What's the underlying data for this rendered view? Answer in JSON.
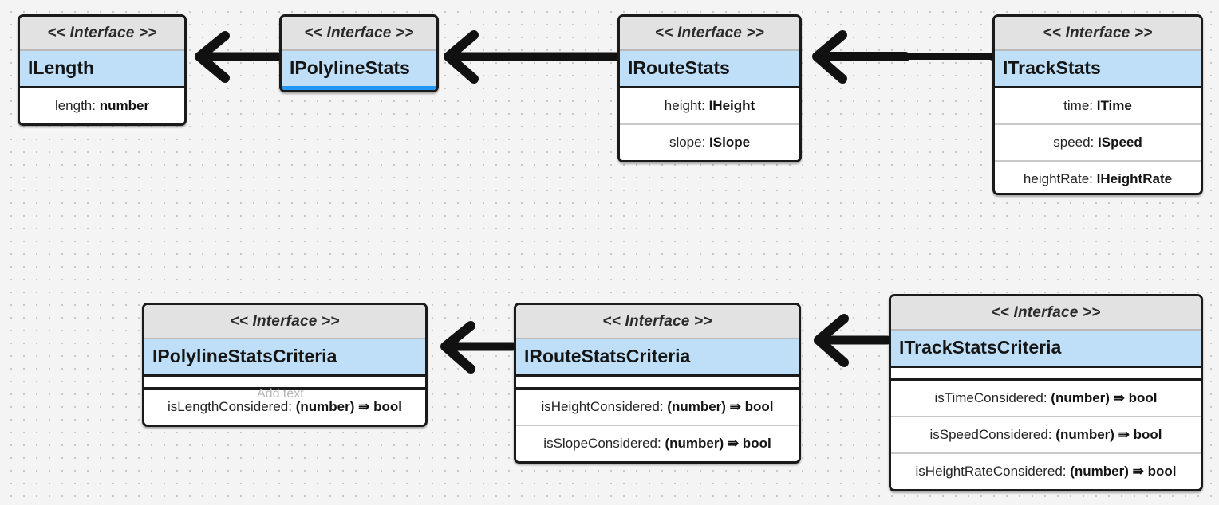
{
  "diagram": {
    "type": "uml-class-diagram",
    "stereotype_label": "<< Interface >>",
    "placeholder_text": "Add text",
    "canvas_background": "#f4f4f4",
    "grid_dot_color": "#c8c8c8",
    "accent_color": "#2196f3",
    "title_band_color": "#bfdef7",
    "stereotype_band_color": "#e2e2e2",
    "border_color": "#1a1a1a",
    "relationship_kind": "generalization-arrow",
    "interfaces": [
      {
        "id": "ilength",
        "name": "ILength",
        "stereotype": "<< Interface >>",
        "selected": false,
        "has_empty_compartment": false,
        "has_tail_compartment": false,
        "members": [
          {
            "label": "length:",
            "type": "number"
          }
        ]
      },
      {
        "id": "ipolylinestats",
        "name": "IPolylineStats",
        "stereotype": "<< Interface >>",
        "selected": true,
        "has_empty_compartment": false,
        "has_tail_compartment": false,
        "members": []
      },
      {
        "id": "iroutestats",
        "name": "IRouteStats",
        "stereotype": "<< Interface >>",
        "selected": false,
        "has_empty_compartment": false,
        "has_tail_compartment": false,
        "members": [
          {
            "label": "height:",
            "type": "IHeight"
          },
          {
            "label": "slope:",
            "type": "ISlope"
          }
        ]
      },
      {
        "id": "itrackstats",
        "name": "ITrackStats",
        "stereotype": "<< Interface >>",
        "selected": false,
        "has_empty_compartment": false,
        "has_tail_compartment": true,
        "members": [
          {
            "label": "time:",
            "type": "ITime"
          },
          {
            "label": "speed:",
            "type": "ISpeed"
          },
          {
            "label": "heightRate:",
            "type": "IHeightRate"
          }
        ]
      },
      {
        "id": "ipolylinestatscriteria",
        "name": "IPolylineStatsCriteria",
        "stereotype": "<< Interface >>",
        "selected": false,
        "has_empty_compartment": true,
        "has_tail_compartment": false,
        "ghost_text": "Add text",
        "members": [
          {
            "label": "isLengthConsidered:",
            "type": "(number) ⇛ bool"
          }
        ]
      },
      {
        "id": "iroutestatscriteria",
        "name": "IRouteStatsCriteria",
        "stereotype": "<< Interface >>",
        "selected": false,
        "has_empty_compartment": true,
        "has_tail_compartment": false,
        "members": [
          {
            "label": "isHeightConsidered:",
            "type": "(number) ⇛ bool"
          },
          {
            "label": "isSlopeConsidered:",
            "type": "(number) ⇛ bool"
          }
        ]
      },
      {
        "id": "itrackstatscriteria",
        "name": "ITrackStatsCriteria",
        "stereotype": "<< Interface >>",
        "selected": false,
        "has_empty_compartment": true,
        "has_tail_compartment": false,
        "members": [
          {
            "label": "isTimeConsidered:",
            "type": "(number) ⇛ bool"
          },
          {
            "label": "isSpeedConsidered:",
            "type": "(number) ⇛ bool"
          },
          {
            "label": "isHeightRateConsidered:",
            "type": "(number) ⇛ bool"
          }
        ]
      }
    ],
    "relationships": [
      {
        "from": "IPolylineStats",
        "to": "ILength"
      },
      {
        "from": "IRouteStats",
        "to": "IPolylineStats"
      },
      {
        "from": "ITrackStats",
        "to": "IRouteStats"
      },
      {
        "from": "IRouteStatsCriteria",
        "to": "IPolylineStatsCriteria"
      },
      {
        "from": "ITrackStatsCriteria",
        "to": "IRouteStatsCriteria"
      }
    ]
  }
}
